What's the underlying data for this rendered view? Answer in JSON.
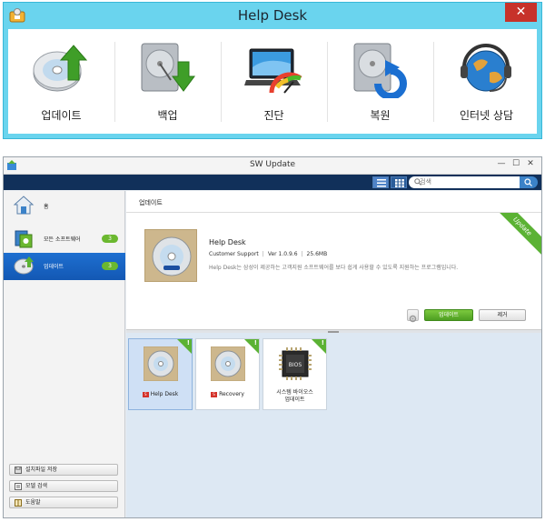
{
  "helpdesk": {
    "title": "Help Desk",
    "close_glyph": "✕",
    "tiles": [
      {
        "label": "업데이트",
        "icon": "disc-upload-icon"
      },
      {
        "label": "백업",
        "icon": "hdd-download-icon"
      },
      {
        "label": "진단",
        "icon": "laptop-gauge-icon"
      },
      {
        "label": "복원",
        "icon": "hdd-restore-icon"
      },
      {
        "label": "인터넷 상담",
        "icon": "globe-headset-icon"
      }
    ]
  },
  "swupdate": {
    "title": "SW Update",
    "controls": {
      "minimize": "—",
      "maximize": "☐",
      "close": "✕"
    },
    "search": {
      "placeholder": "검색"
    },
    "sidebar": {
      "items": [
        {
          "label": "홈",
          "count": ""
        },
        {
          "label": "모든 소프트웨어",
          "count": "3"
        },
        {
          "label": "업데이트",
          "count": "3"
        }
      ],
      "buttons": [
        {
          "label": "설치파일 저장"
        },
        {
          "label": "모델 검색"
        },
        {
          "label": "도움말"
        }
      ]
    },
    "main": {
      "header": "업데이트",
      "detail": {
        "name": "Help Desk",
        "publisher": "Customer Support",
        "version": "Ver 1.0.9.6",
        "size": "25.6MB",
        "description": "Help Desk는 삼성이 제공하는 고객지원 소프트웨어를 보다 쉽게 사용할 수 있도록 지원하는 프로그램입니다.",
        "ribbon": "Update",
        "update_button": "업데이트",
        "remove_button": "제거"
      },
      "cards": [
        {
          "label": "Help Desk",
          "selected": true
        },
        {
          "label": "Recovery",
          "selected": false
        },
        {
          "label_line1": "시스템 바이오스",
          "label_line2": "업데이트",
          "chip_text": "BIOS",
          "selected": false
        }
      ]
    }
  },
  "colors": {
    "helpdesk_frame": "#6ad4ee",
    "close_red": "#c7322a",
    "toolbar_navy": "#11305a",
    "sidebar_active": "#1e6fd0",
    "accent_green": "#5bb234"
  }
}
